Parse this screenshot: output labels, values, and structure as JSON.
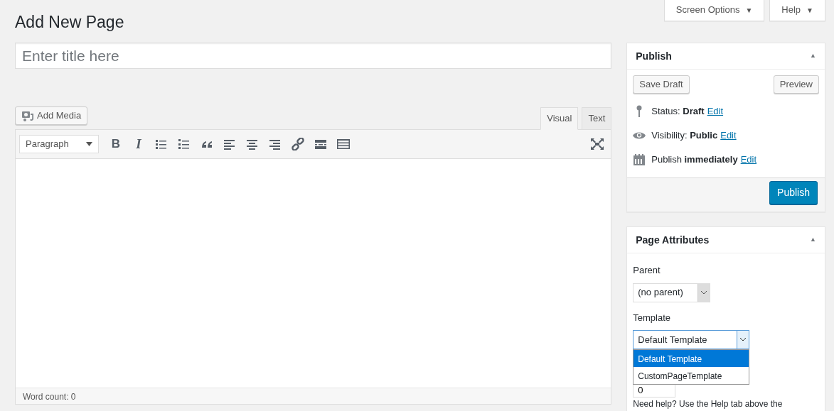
{
  "screen_meta": [
    {
      "label": "Screen Options",
      "caret": "▼"
    },
    {
      "label": "Help",
      "caret": "▼"
    }
  ],
  "heading": "Add New Page",
  "title_field": {
    "placeholder": "Enter title here"
  },
  "add_media": "Add Media",
  "editor_tabs": [
    {
      "label": "Visual",
      "selected": true
    },
    {
      "label": "Text",
      "selected": false
    }
  ],
  "format_select": {
    "value": "Paragraph"
  },
  "toolbar": [
    {
      "kind": "bold",
      "text": "B"
    },
    {
      "kind": "italic",
      "text": "I"
    },
    {
      "kind": "bullets"
    },
    {
      "kind": "numbers"
    },
    {
      "kind": "quote"
    },
    {
      "kind": "align-left"
    },
    {
      "kind": "align-center"
    },
    {
      "kind": "align-right"
    },
    {
      "kind": "link"
    },
    {
      "kind": "more"
    },
    {
      "kind": "toolbar-toggle"
    }
  ],
  "word_count": "Word count: 0",
  "publish_box": {
    "title": "Publish",
    "toggle": "▲",
    "save_draft": "Save Draft",
    "preview": "Preview",
    "rows": [
      {
        "kind": "status",
        "text": "Status: **Draft**",
        "link": "Edit"
      },
      {
        "kind": "visibility",
        "text": "Visibility: **Public**",
        "link": "Edit"
      },
      {
        "kind": "schedule",
        "text": "Publish **immediately**",
        "link": "Edit"
      }
    ],
    "publish": "Publish"
  },
  "page_attributes": {
    "title": "Page Attributes",
    "toggle": "▲",
    "parent_label": "Parent",
    "parent_value": "(no parent)",
    "template_label": "Template",
    "template_value": "Default Template",
    "template_options": [
      {
        "label": "Default Template",
        "selected": true
      },
      {
        "label": "CustomPageTemplate",
        "selected": false
      }
    ],
    "order_value": "0",
    "help": "Need help? Use the Help tab above the"
  }
}
